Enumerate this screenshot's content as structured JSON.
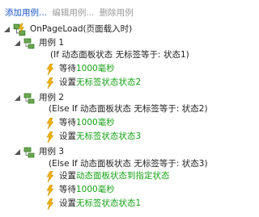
{
  "toolbar": {
    "add_case": "添加用例...",
    "edit_case": "编辑用例...",
    "delete_case": "删除用例"
  },
  "tree": {
    "event": {
      "label": "OnPageLoad(页面载入时)"
    },
    "cases": [
      {
        "title": "用例 1",
        "condition": "(If 动态面板状态 无标签等于: 状态1)",
        "actions": [
          {
            "type": "wait",
            "prefix": "等待",
            "value": "1000毫秒"
          },
          {
            "type": "set",
            "prefix": "设置 ",
            "value": "无标签状态状态2"
          }
        ]
      },
      {
        "title": "用例 2",
        "condition": "(Else If 动态面板状态 无标签等于: 状态2)",
        "actions": [
          {
            "type": "wait",
            "prefix": "等待",
            "value": "1000毫秒"
          },
          {
            "type": "set",
            "prefix": "设置 ",
            "value": "无标签状态状态3"
          }
        ]
      },
      {
        "title": "用例 3",
        "condition": "(Else If 动态面板状态 无标签等于: 状态3)",
        "actions": [
          {
            "type": "set",
            "prefix": "设置 ",
            "value": "动态面板状态到指定状态"
          },
          {
            "type": "wait",
            "prefix": "等待",
            "value": "1000毫秒"
          },
          {
            "type": "set",
            "prefix": "设置 ",
            "value": "无标签状态状态1"
          }
        ]
      }
    ]
  },
  "colors": {
    "link": "#1a53c6",
    "disabled": "#9a9a9a",
    "value_green": "#16a216",
    "bolt": "#f2b200",
    "case_icon": "#5aa02c"
  },
  "icons": {
    "event": "lightning-tree-icon",
    "case": "case-tree-icon",
    "wait": "lightning-icon",
    "set": "lightning-icon",
    "toggle": "collapse-triangle-icon"
  }
}
